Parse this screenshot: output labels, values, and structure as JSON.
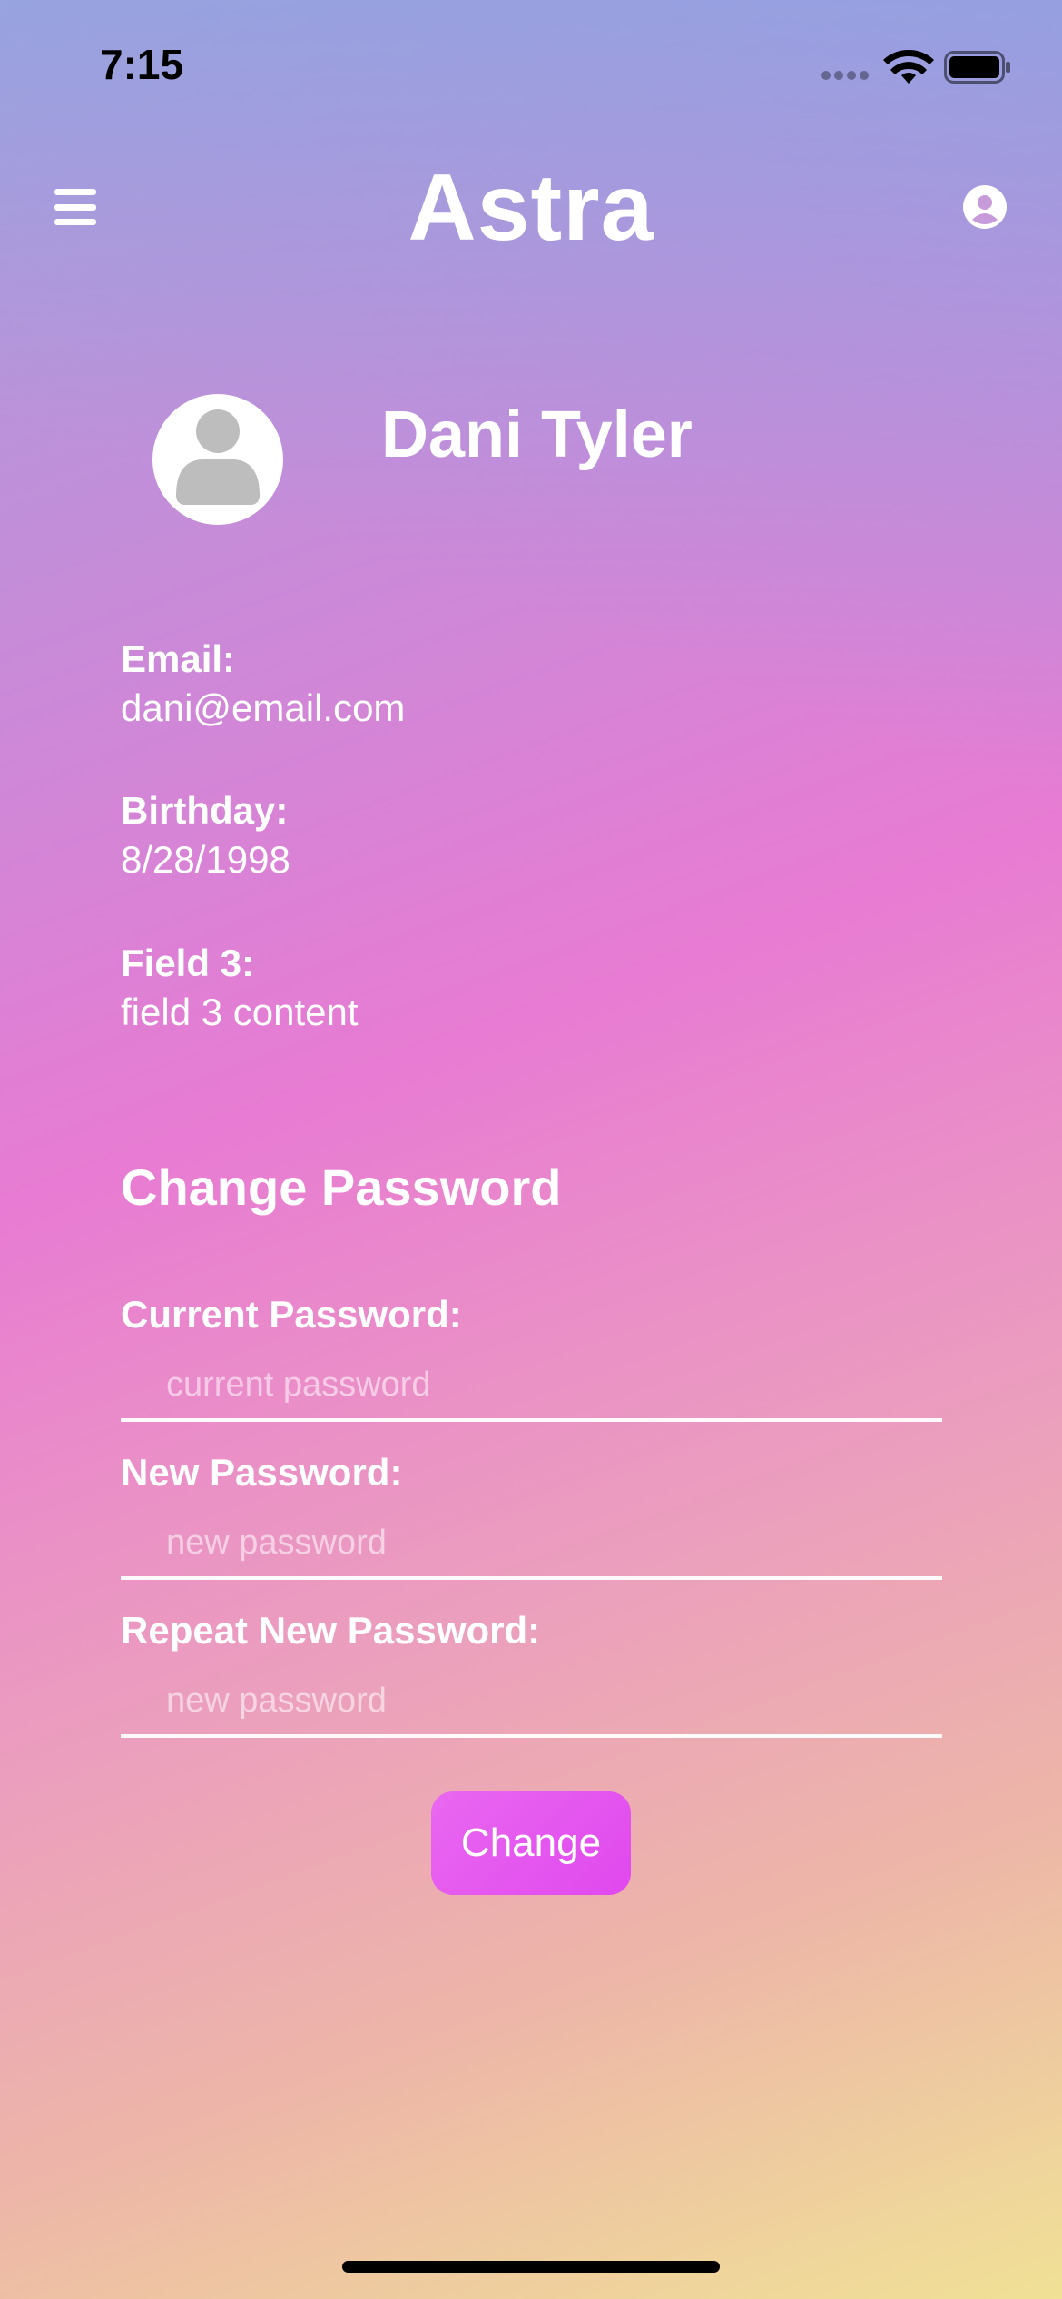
{
  "status_bar": {
    "time": "7:15"
  },
  "header": {
    "title": "Astra",
    "menu_icon": "hamburger-icon",
    "profile_icon": "user-circle-icon"
  },
  "profile": {
    "name": "Dani Tyler",
    "avatar_icon": "person-avatar-icon",
    "fields": [
      {
        "label": "Email:",
        "value": "dani@email.com"
      },
      {
        "label": "Birthday:",
        "value": "8/28/1998"
      },
      {
        "label": "Field 3:",
        "value": "field 3 content"
      }
    ]
  },
  "change_password": {
    "title": "Change Password",
    "current": {
      "label": "Current Password:",
      "placeholder": "current password"
    },
    "new": {
      "label": "New Password:",
      "placeholder": "new password"
    },
    "repeat": {
      "label": "Repeat New Password:",
      "placeholder": "new password"
    },
    "button_label": "Change"
  },
  "colors": {
    "accent_button": "#e455ee",
    "text": "#ffffff",
    "avatar_gray": "#bdbdbd"
  }
}
